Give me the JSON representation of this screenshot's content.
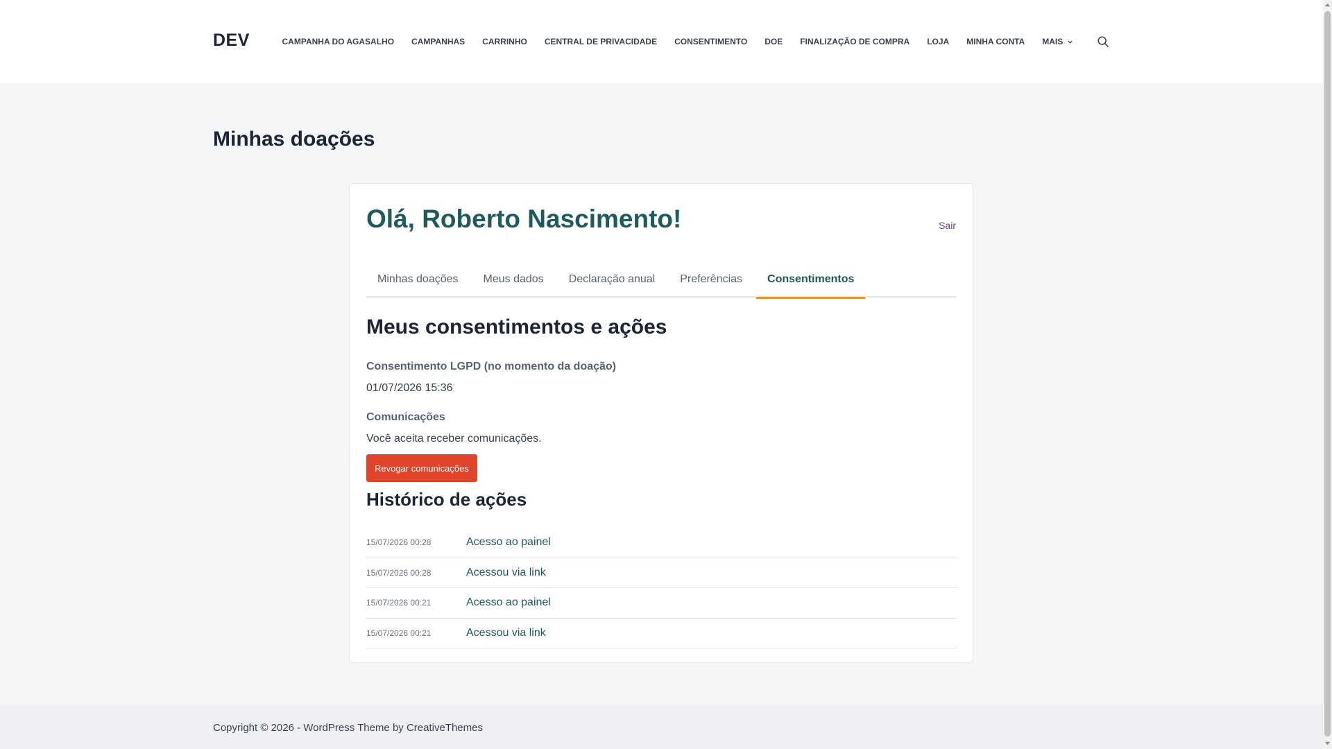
{
  "site": {
    "logo": "DEV"
  },
  "nav": {
    "items": [
      "CAMPANHA DO AGASALHO",
      "CAMPANHAS",
      "CARRINHO",
      "CENTRAL DE PRIVACIDADE",
      "CONSENTIMENTO",
      "DOE",
      "FINALIZAÇÃO DE COMPRA",
      "LOJA",
      "MINHA CONTA",
      "MAIS"
    ]
  },
  "page": {
    "title": "Minhas doações"
  },
  "panel": {
    "greeting": "Olá, Roberto Nascimento!",
    "logout": "Sair",
    "tabs": [
      "Minhas doações",
      "Meus dados",
      "Declaração anual",
      "Preferências",
      "Consentimentos"
    ],
    "active_tab": "Consentimentos",
    "section_title": "Meus consentimentos e ações",
    "lgpd_label": "Consentimento LGPD (no momento da doação)",
    "lgpd_value": "01/07/2026 15:36",
    "comms_label": "Comunicações",
    "comms_value": "Você aceita receber comunicações.",
    "revoke_button": "Revogar comunicações",
    "history_title": "Histórico de ações",
    "history": [
      {
        "date": "15/07/2026 00:28",
        "action": "Acesso ao painel"
      },
      {
        "date": "15/07/2026 00:28",
        "action": "Acessou via link"
      },
      {
        "date": "15/07/2026 00:21",
        "action": "Acesso ao painel"
      },
      {
        "date": "15/07/2026 00:21",
        "action": "Acessou via link"
      }
    ]
  },
  "footer": {
    "copyright": "Copyright © 2026 - WordPress Theme by CreativeThemes"
  },
  "colors": {
    "accent_teal": "#1f5a5c",
    "tab_underline": "#e8953a",
    "button_red": "#e0442a",
    "logout_purple": "#6b3fa0"
  }
}
